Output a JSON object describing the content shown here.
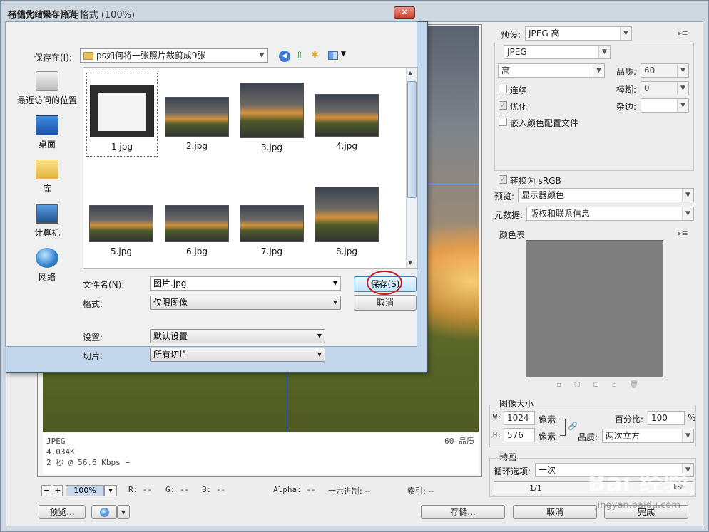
{
  "window": {
    "title": "存储为 Web 所用格式 (100%)"
  },
  "preview": {
    "format": "JPEG",
    "size": "4.034K",
    "speed": "2 秒 @ 56.6 Kbps",
    "quality": "60 品质",
    "menu_icon": "≡"
  },
  "bottom": {
    "zoom_minus": "−",
    "zoom_plus": "+",
    "zoom": "100%",
    "r": "R: --",
    "g": "G: --",
    "b": "B: --",
    "alpha": "Alpha: --",
    "hex": "十六进制: --",
    "index": "索引: --",
    "preview_btn": "预览...",
    "save_btn": "存储...",
    "cancel_btn": "取消",
    "done_btn": "完成"
  },
  "settings": {
    "preset_label": "预设:",
    "preset_value": "JPEG 高",
    "format_value": "JPEG",
    "compression_value": "高",
    "quality_label": "品质:",
    "quality_value": "60",
    "blur_label": "模糊:",
    "blur_value": "0",
    "matte_label": "杂边:",
    "progressive_label": "连续",
    "optimized_label": "优化",
    "embed_profile_label": "嵌入颜色配置文件",
    "srgb_label": "转换为 sRGB",
    "preview_label": "预览:",
    "preview_value": "显示器颜色",
    "metadata_label": "元数据:",
    "metadata_value": "版权和联系信息",
    "color_table_label": "颜色表",
    "image_size_label": "图像大小",
    "w_label": "W:",
    "w_value": "1024",
    "h_label": "H:",
    "h_value": "576",
    "px_unit": "像素",
    "percent_label": "百分比:",
    "percent_value": "100",
    "percent_unit": "%",
    "quality2_label": "品质:",
    "quality2_value": "两次立方",
    "animation_label": "动画",
    "loop_label": "循环选项:",
    "loop_value": "一次",
    "frame_counter": "1/1"
  },
  "dialog": {
    "title": "将优化结果存储为",
    "close": "✕",
    "save_in_label": "保存在(I):",
    "folder": "ps如何将一张照片裁剪成9张",
    "places": [
      "最近访问的位置",
      "桌面",
      "库",
      "计算机",
      "网络"
    ],
    "files": [
      "1.jpg",
      "2.jpg",
      "3.jpg",
      "4.jpg",
      "5.jpg",
      "6.jpg",
      "7.jpg",
      "8.jpg"
    ],
    "filename_label": "文件名(N):",
    "filename_value": "图片.jpg",
    "format_label": "格式:",
    "format_value": "仅限图像",
    "save_button": "保存(S)",
    "cancel_button": "取消",
    "settings_label": "设置:",
    "settings_value": "默认设置",
    "slices_label": "切片:",
    "slices_value": "所有切片"
  },
  "watermark": {
    "logo": "Bai 经验",
    "url": "jingyan.baidu.com"
  }
}
